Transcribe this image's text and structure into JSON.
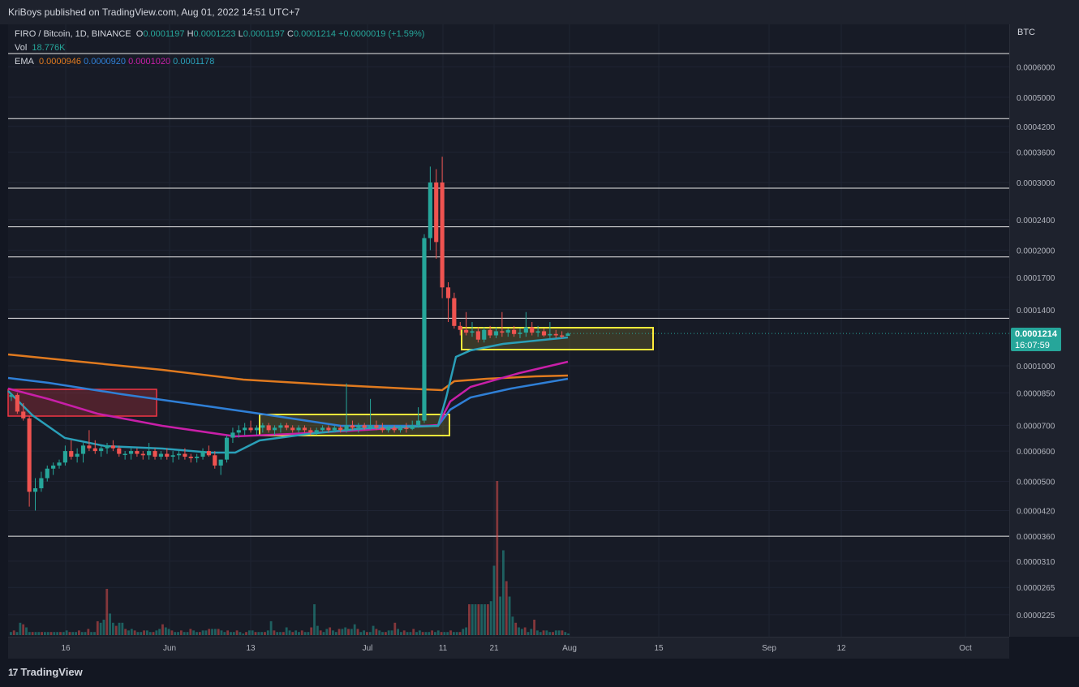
{
  "header": {
    "publisher_line": "KriBoys published on TradingView.com, Aug 01, 2022 14:51 UTC+7"
  },
  "legend": {
    "symbol": "FIRO / Bitcoin, 1D, BINANCE",
    "open_label": "O",
    "open": "0.0001197",
    "high_label": "H",
    "high": "0.0001223",
    "low_label": "L",
    "low": "0.0001197",
    "close_label": "C",
    "close": "0.0001214",
    "change": "+0.0000019 (+1.59%)",
    "vol_label": "Vol",
    "vol": "18.776K",
    "ema_label": "EMA",
    "ema_values": [
      "0.0000946",
      "0.0000920",
      "0.0001020",
      "0.0001178"
    ]
  },
  "price_axis": {
    "currency": "BTC"
  },
  "last_price": {
    "value": "0.0001214",
    "countdown": "16:07:59"
  },
  "footer": {
    "brand": "TradingView"
  },
  "colors": {
    "up": "#26a69a",
    "down": "#ef5350",
    "ema_orange": "#e07a1f",
    "ema_blue": "#2f7fd6",
    "ema_magenta": "#c81fa8",
    "ema_teal": "#2a9fb8",
    "zone_yellow": "#ffeb3b",
    "zone_red": "#f23645"
  },
  "chart_data": {
    "type": "candlestick",
    "scale": "log",
    "symbol": "FIRO / Bitcoin",
    "interval": "1D",
    "exchange": "BINANCE",
    "y_ticks": [
      "0.0006000",
      "0.0005000",
      "0.0004200",
      "0.0003600",
      "0.0003000",
      "0.0002400",
      "0.0002000",
      "0.0001700",
      "0.0001400",
      "0.0001000",
      "0.0000850",
      "0.0000700",
      "0.0000600",
      "0.0000500",
      "0.0000420",
      "0.0000360",
      "0.0000310",
      "0.0000265",
      "0.0000225"
    ],
    "x_ticks": [
      "16",
      "Jun",
      "13",
      "Jul",
      "11",
      "21",
      "Aug",
      "15",
      "Sep",
      "12",
      "Oct"
    ],
    "horizontal_levels": [
      0.00065,
      0.00044,
      0.00029,
      0.00023,
      0.000192,
      0.000133,
      3.6e-05
    ],
    "candles": [
      [
        8.3e-05,
        8.5e-05,
        8.1e-05,
        8.4e-05
      ],
      [
        8.4e-05,
        8.5e-05,
        7.5e-05,
        7.6e-05
      ],
      [
        7.6e-05,
        8e-05,
        7.2e-05,
        7.3e-05
      ],
      [
        7.3e-05,
        7.4e-05,
        4.3e-05,
        4.7e-05
      ],
      [
        4.7e-05,
        5.1e-05,
        4.2e-05,
        4.8e-05
      ],
      [
        4.8e-05,
        5.3e-05,
        4.7e-05,
        5.1e-05
      ],
      [
        5.1e-05,
        5.5e-05,
        5e-05,
        5.4e-05
      ],
      [
        5.4e-05,
        5.6e-05,
        5.2e-05,
        5.5e-05
      ],
      [
        5.5e-05,
        5.7e-05,
        5.4e-05,
        5.6e-05
      ],
      [
        5.6e-05,
        6.2e-05,
        5.5e-05,
        6e-05
      ],
      [
        6e-05,
        6.4e-05,
        5.7e-05,
        5.8e-05
      ],
      [
        5.8e-05,
        6.1e-05,
        5.6e-05,
        5.9e-05
      ],
      [
        5.9e-05,
        6.3e-05,
        5.6e-05,
        6.2e-05
      ],
      [
        6.2e-05,
        6.8e-05,
        6e-05,
        6.1e-05
      ],
      [
        6.1e-05,
        6.4e-05,
        5.9e-05,
        6e-05
      ],
      [
        6e-05,
        6.2e-05,
        5.8e-05,
        6.1e-05
      ],
      [
        6.1e-05,
        6.3e-05,
        5.9e-05,
        6.2e-05
      ],
      [
        6.2e-05,
        6.4e-05,
        6e-05,
        6.1e-05
      ],
      [
        6.1e-05,
        6.2e-05,
        5.8e-05,
        5.9e-05
      ],
      [
        5.9e-05,
        6e-05,
        5.7e-05,
        5.9e-05
      ],
      [
        5.9e-05,
        6.1e-05,
        5.7e-05,
        6e-05
      ],
      [
        6e-05,
        6.1e-05,
        5.8e-05,
        5.9e-05
      ],
      [
        5.9e-05,
        6e-05,
        5.7e-05,
        5.85e-05
      ],
      [
        5.85e-05,
        6.3e-05,
        5.7e-05,
        6e-05
      ],
      [
        6e-05,
        6.1e-05,
        5.7e-05,
        5.8e-05
      ],
      [
        5.8e-05,
        6e-05,
        5.7e-05,
        5.9e-05
      ],
      [
        5.9e-05,
        6.1e-05,
        5.7e-05,
        5.8e-05
      ],
      [
        5.8e-05,
        6e-05,
        5.6e-05,
        5.85e-05
      ],
      [
        5.85e-05,
        6e-05,
        5.7e-05,
        5.9e-05
      ],
      [
        5.9e-05,
        6.1e-05,
        5.7e-05,
        5.8e-05
      ],
      [
        5.8e-05,
        5.9e-05,
        5.6e-05,
        5.75e-05
      ],
      [
        5.75e-05,
        5.9e-05,
        5.6e-05,
        5.8e-05
      ],
      [
        5.8e-05,
        6.1e-05,
        5.7e-05,
        6e-05
      ],
      [
        6e-05,
        6.2e-05,
        5.8e-05,
        5.85e-05
      ],
      [
        5.85e-05,
        6e-05,
        5.4e-05,
        5.5e-05
      ],
      [
        5.5e-05,
        5.7e-05,
        5.2e-05,
        5.7e-05
      ],
      [
        5.7e-05,
        6.6e-05,
        5.6e-05,
        6.5e-05
      ],
      [
        6.5e-05,
        6.9e-05,
        6.3e-05,
        6.7e-05
      ],
      [
        6.7e-05,
        7e-05,
        6.5e-05,
        6.8e-05
      ],
      [
        6.8e-05,
        7.1e-05,
        6.6e-05,
        6.9e-05
      ],
      [
        6.9e-05,
        7.2e-05,
        6.7e-05,
        6.8e-05
      ],
      [
        6.8e-05,
        7e-05,
        6.6e-05,
        6.9e-05
      ],
      [
        6.9e-05,
        7.1e-05,
        6.7e-05,
        7e-05
      ],
      [
        7e-05,
        7.1e-05,
        6.7e-05,
        6.8e-05
      ],
      [
        6.8e-05,
        7e-05,
        6.6e-05,
        6.9e-05
      ],
      [
        6.9e-05,
        7.1e-05,
        6.7e-05,
        7e-05
      ],
      [
        7e-05,
        7.1e-05,
        6.8e-05,
        6.9e-05
      ],
      [
        6.9e-05,
        7e-05,
        6.7e-05,
        6.8e-05
      ],
      [
        6.8e-05,
        7e-05,
        6.7e-05,
        6.9e-05
      ],
      [
        6.9e-05,
        7e-05,
        6.7e-05,
        6.8e-05
      ],
      [
        6.8e-05,
        6.9e-05,
        6.6e-05,
        6.7e-05
      ],
      [
        6.7e-05,
        6.9e-05,
        6.6e-05,
        6.8e-05
      ],
      [
        6.8e-05,
        7e-05,
        6.7e-05,
        6.9e-05
      ],
      [
        6.9e-05,
        7e-05,
        6.7e-05,
        6.8e-05
      ],
      [
        6.8e-05,
        7e-05,
        6.7e-05,
        6.9e-05
      ],
      [
        6.9e-05,
        7e-05,
        6.7e-05,
        6.8e-05
      ],
      [
        6.8e-05,
        9e-05,
        6.7e-05,
        7e-05
      ],
      [
        7e-05,
        7.2e-05,
        6.8e-05,
        6.9e-05
      ],
      [
        6.9e-05,
        7.1e-05,
        6.7e-05,
        7e-05
      ],
      [
        7e-05,
        7.1e-05,
        6.8e-05,
        6.9e-05
      ],
      [
        6.9e-05,
        8.2e-05,
        6.8e-05,
        7e-05
      ],
      [
        7e-05,
        7.2e-05,
        6.8e-05,
        6.9e-05
      ],
      [
        6.9e-05,
        7.1e-05,
        6.7e-05,
        6.8e-05
      ],
      [
        6.8e-05,
        7e-05,
        6.7e-05,
        6.9e-05
      ],
      [
        6.9e-05,
        7e-05,
        6.7e-05,
        6.8e-05
      ],
      [
        6.8e-05,
        7e-05,
        6.7e-05,
        6.9e-05
      ],
      [
        6.9e-05,
        7.1e-05,
        6.7e-05,
        6.85e-05
      ],
      [
        6.85e-05,
        7.2e-05,
        6.8e-05,
        7e-05
      ],
      [
        7e-05,
        7.8e-05,
        6.9e-05,
        7.2e-05
      ],
      [
        7.2e-05,
        0.00022,
        7.1e-05,
        0.000215
      ],
      [
        0.000215,
        0.00033,
        0.0002,
        0.0003
      ],
      [
        0.0003,
        0.000325,
        0.00019,
        0.00021
      ],
      [
        0.0003,
        0.00035,
        0.00015,
        0.00016
      ],
      [
        0.00016,
        0.000165,
        0.00013,
        0.00015
      ],
      [
        0.00015,
        0.000155,
        0.000125,
        0.000127
      ],
      [
        0.000127,
        0.00013,
        0.00012,
        0.000124
      ],
      [
        0.000124,
        0.000138,
        0.00012,
        0.000122
      ],
      [
        0.000122,
        0.00013,
        0.000119,
        0.000123
      ],
      [
        0.000123,
        0.000126,
        0.000115,
        0.000117
      ],
      [
        0.000117,
        0.000126,
        0.000115,
        0.000124
      ],
      [
        0.000124,
        0.000127,
        0.000118,
        0.00012
      ],
      [
        0.00012,
        0.000126,
        0.000118,
        0.000123
      ],
      [
        0.000123,
        0.000138,
        0.000119,
        0.000122
      ],
      [
        0.000122,
        0.000125,
        0.000119,
        0.000124
      ],
      [
        0.000124,
        0.000127,
        0.000119,
        0.000121
      ],
      [
        0.000121,
        0.000125,
        0.000118,
        0.000122
      ],
      [
        0.000122,
        0.000138,
        0.000119,
        0.000126
      ],
      [
        0.000126,
        0.00013,
        0.00012,
        0.000122
      ],
      [
        0.000122,
        0.000127,
        0.000119,
        0.000123
      ],
      [
        0.000123,
        0.000125,
        0.000119,
        0.00012
      ],
      [
        0.00012,
        0.00013,
        0.000118,
        0.000121
      ],
      [
        0.000121,
        0.000124,
        0.000118,
        0.00012
      ],
      [
        0.00012,
        0.000123,
        0.000118,
        0.0001197
      ],
      [
        0.0001197,
        0.0001223,
        0.0001197,
        0.0001214
      ]
    ],
    "volume": [
      2,
      3,
      2,
      8,
      7,
      5,
      2,
      2,
      2,
      2,
      2,
      2,
      2,
      2,
      2,
      2,
      2,
      2,
      3,
      2,
      2,
      2,
      3,
      2,
      2,
      4,
      2,
      2,
      9,
      8,
      10,
      30,
      14,
      8,
      6,
      8,
      8,
      4,
      3,
      4,
      3,
      2,
      2,
      3,
      3,
      2,
      2,
      3,
      4,
      7,
      5,
      4,
      3,
      2,
      2,
      3,
      2,
      2,
      4,
      3,
      2,
      2,
      3,
      3,
      4,
      4,
      4,
      4,
      3,
      2,
      3,
      2,
      2,
      3,
      2,
      1,
      2,
      3,
      3,
      2,
      2,
      2,
      2,
      3,
      9,
      3,
      2,
      2,
      2,
      5,
      3,
      2,
      3,
      2,
      3,
      2,
      2,
      5,
      20,
      6,
      3,
      2,
      4,
      5,
      3,
      2,
      4,
      4,
      5,
      4,
      4,
      7,
      4,
      2,
      3,
      2,
      2,
      6,
      4,
      3,
      2,
      2,
      3,
      3,
      8,
      4,
      2,
      3,
      2,
      2,
      4,
      2,
      3,
      2,
      2,
      2,
      3,
      2,
      3,
      2,
      2,
      2,
      3,
      2,
      2,
      2,
      4,
      5,
      20,
      20,
      20,
      20,
      20,
      20,
      20,
      22,
      45,
      100,
      25,
      55,
      35,
      25,
      12,
      8,
      5,
      4,
      5,
      2,
      4,
      10,
      3,
      2,
      3,
      3,
      2,
      2,
      3,
      3,
      3,
      2,
      1
    ],
    "ema_series": [
      {
        "period_value": "0.0000946",
        "color": "#e07a1f"
      },
      {
        "period_value": "0.0000920",
        "color": "#2f7fd6"
      },
      {
        "period_value": "0.0001020",
        "color": "#c81fa8"
      },
      {
        "period_value": "0.0001178",
        "color": "#2a9fb8"
      }
    ]
  }
}
